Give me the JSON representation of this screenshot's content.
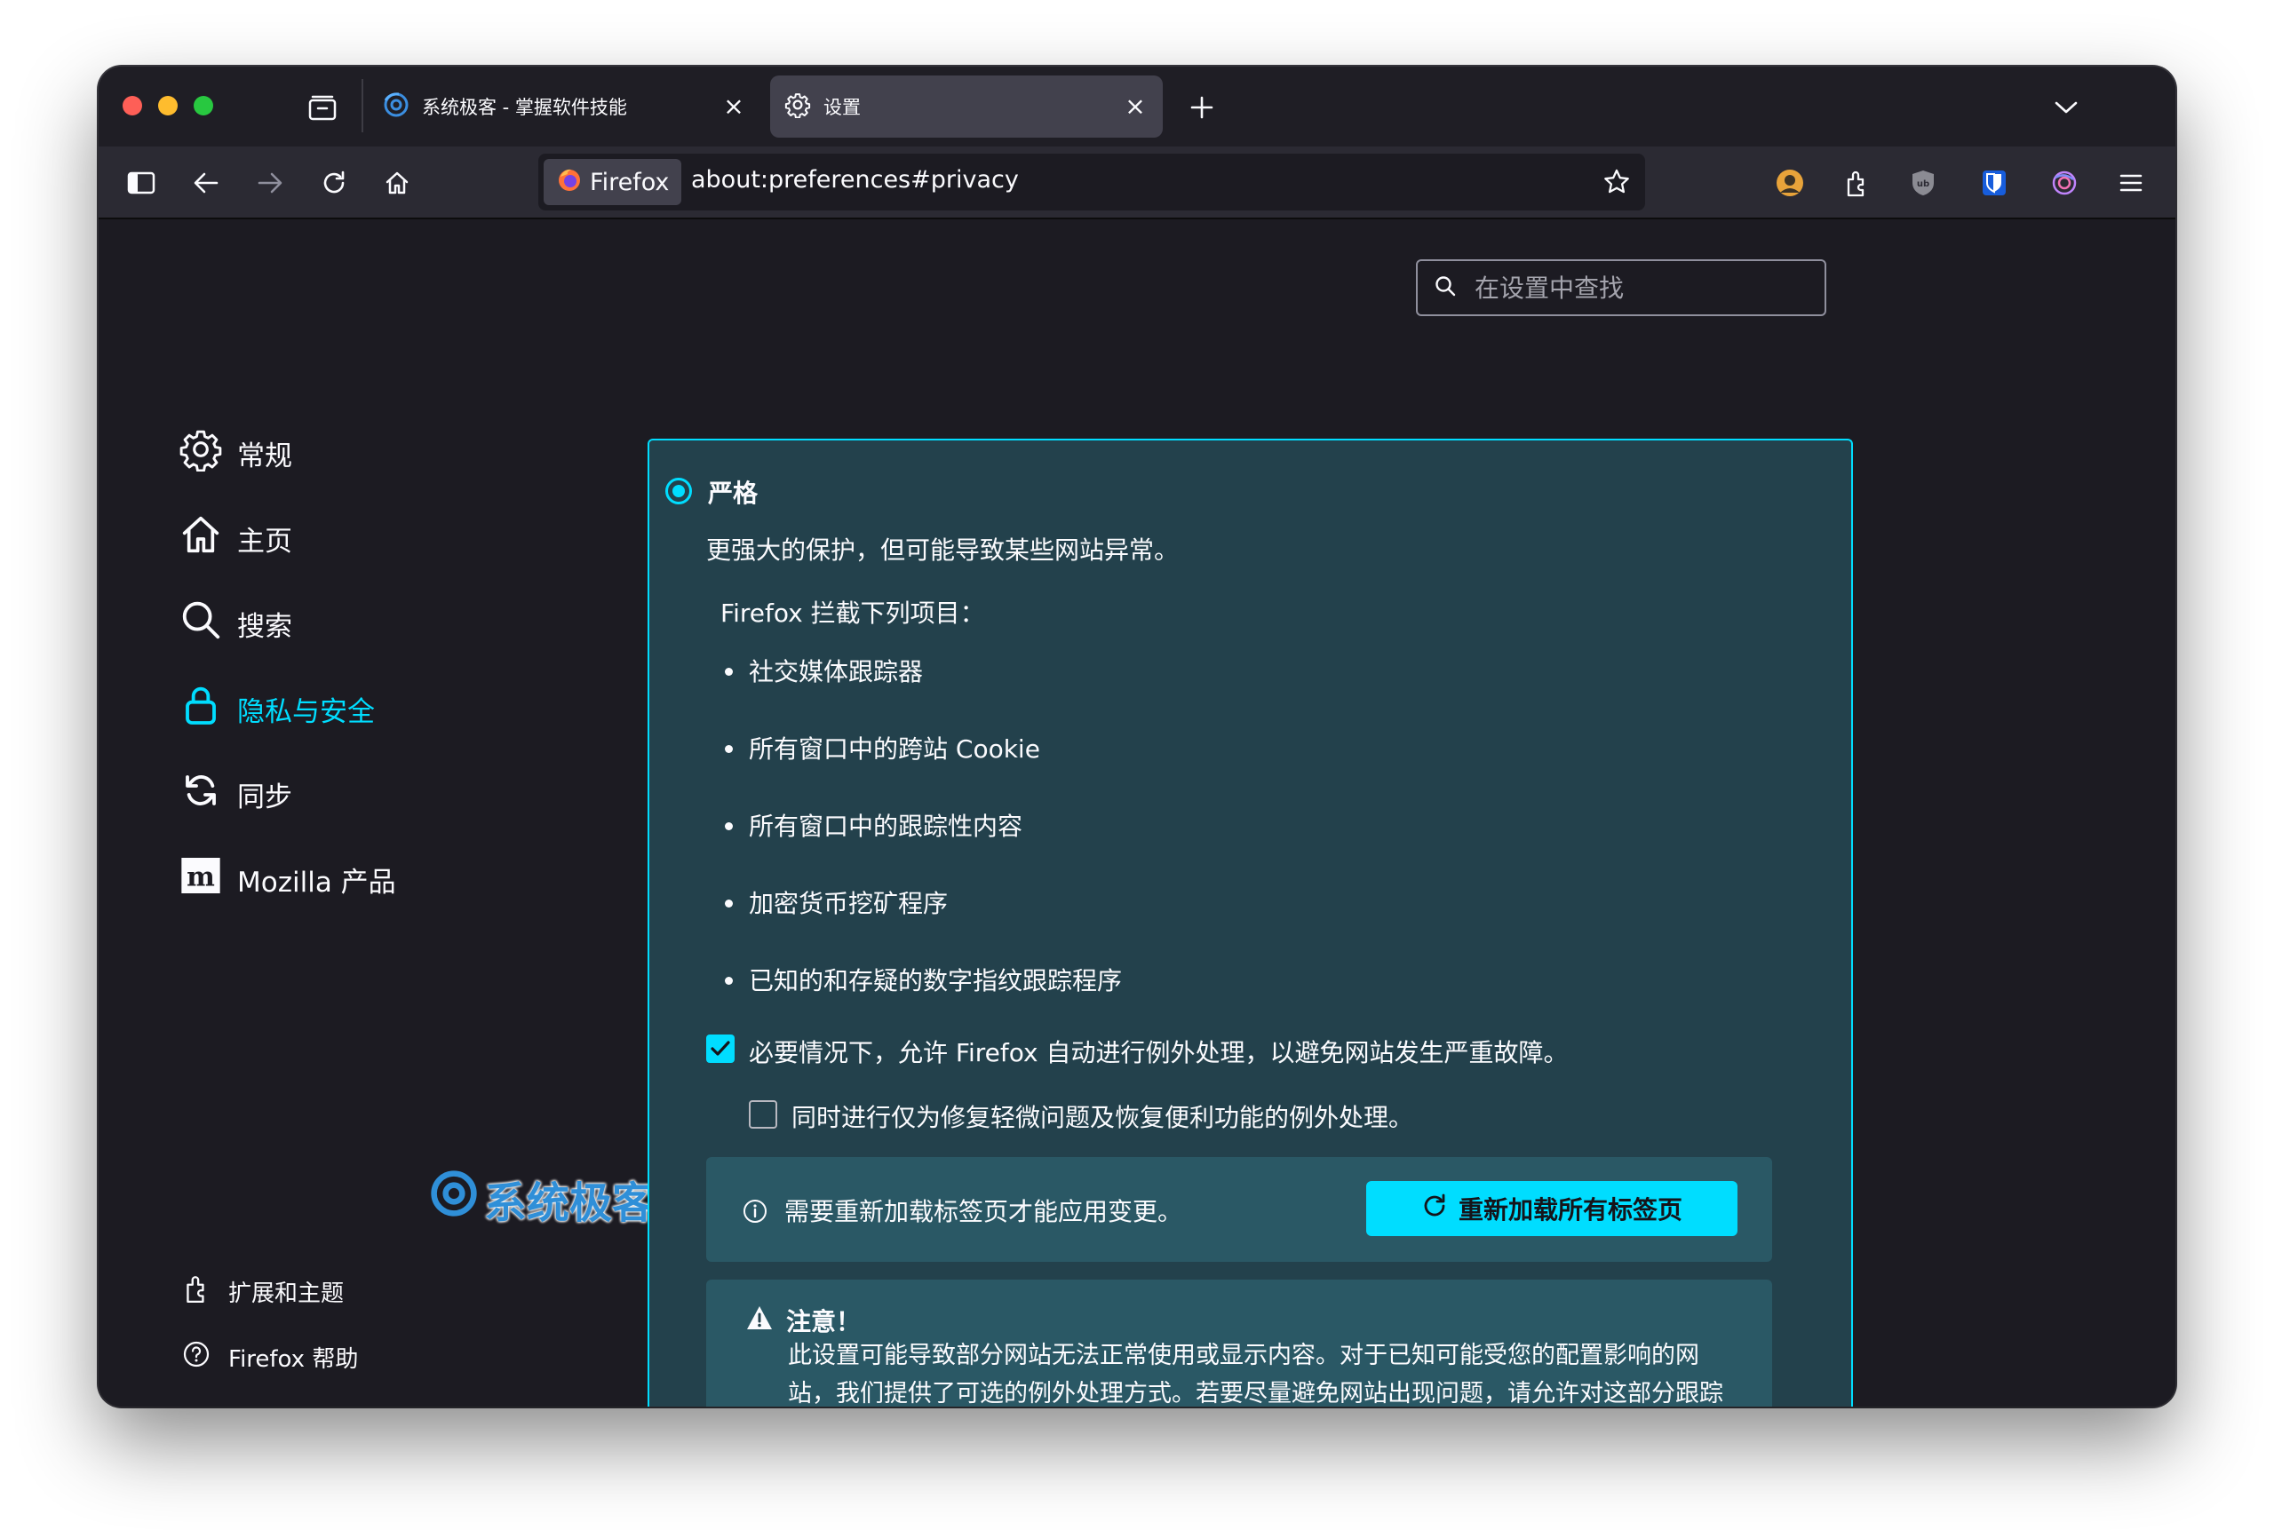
{
  "tabs": [
    {
      "title": "系统极客 - 掌握软件技能",
      "icon": "site-logo-icon",
      "active": false
    },
    {
      "title": "设置",
      "icon": "gear-icon",
      "active": true
    }
  ],
  "urlbar": {
    "identity_label": "Firefox",
    "url": "about:preferences#privacy"
  },
  "search": {
    "placeholder": "在设置中查找"
  },
  "sidebar": {
    "items": [
      {
        "label": "常规",
        "icon": "gear-icon"
      },
      {
        "label": "主页",
        "icon": "home-icon"
      },
      {
        "label": "搜索",
        "icon": "search-icon"
      },
      {
        "label": "隐私与安全",
        "icon": "lock-icon",
        "active": true
      },
      {
        "label": "同步",
        "icon": "sync-icon"
      },
      {
        "label": "Mozilla 产品",
        "icon": "mozilla-logo-icon"
      }
    ],
    "bottom": [
      {
        "label": "扩展和主题",
        "icon": "puzzle-icon"
      },
      {
        "label": "Firefox 帮助",
        "icon": "help-icon"
      }
    ]
  },
  "watermark": {
    "text": "系统极客"
  },
  "strict": {
    "title": "严格",
    "description": "更强大的保护，但可能导致某些网站异常。",
    "blocks_heading": "Firefox 拦截下列项目：",
    "blocked_items": [
      "社交媒体跟踪器",
      "所有窗口中的跨站 Cookie",
      "所有窗口中的跟踪性内容",
      "加密货币挖矿程序",
      "已知的和存疑的数字指纹跟踪程序"
    ],
    "checkbox_exceptions": {
      "label": "必要情况下，允许 Firefox 自动进行例外处理，以避免网站发生严重故障。",
      "checked": true
    },
    "checkbox_minor": {
      "label": "同时进行仅为修复轻微问题及恢复便利功能的例外处理。",
      "checked": false
    },
    "reload_notice": "需要重新加载标签页才能应用变更。",
    "reload_button": "重新加载所有标签页",
    "warning_title": "注意！",
    "warning_body": "此设置可能导致部分网站无法正常使用或显示内容。对于已知可能受您的配置影响的网站，我们提供了可选的例外处理方式。若要尽量避免网站出现问题，请允许对这部分跟踪器进行例外处理。若网站似乎出现问题，您可为其关闭跟踪保护，以加载所有内容；并反馈相关问题，以便我们为全体用户修复"
  },
  "colors": {
    "accent": "#00ddff",
    "panel_bg": "#23414c",
    "window_bg": "#1c1b22"
  }
}
